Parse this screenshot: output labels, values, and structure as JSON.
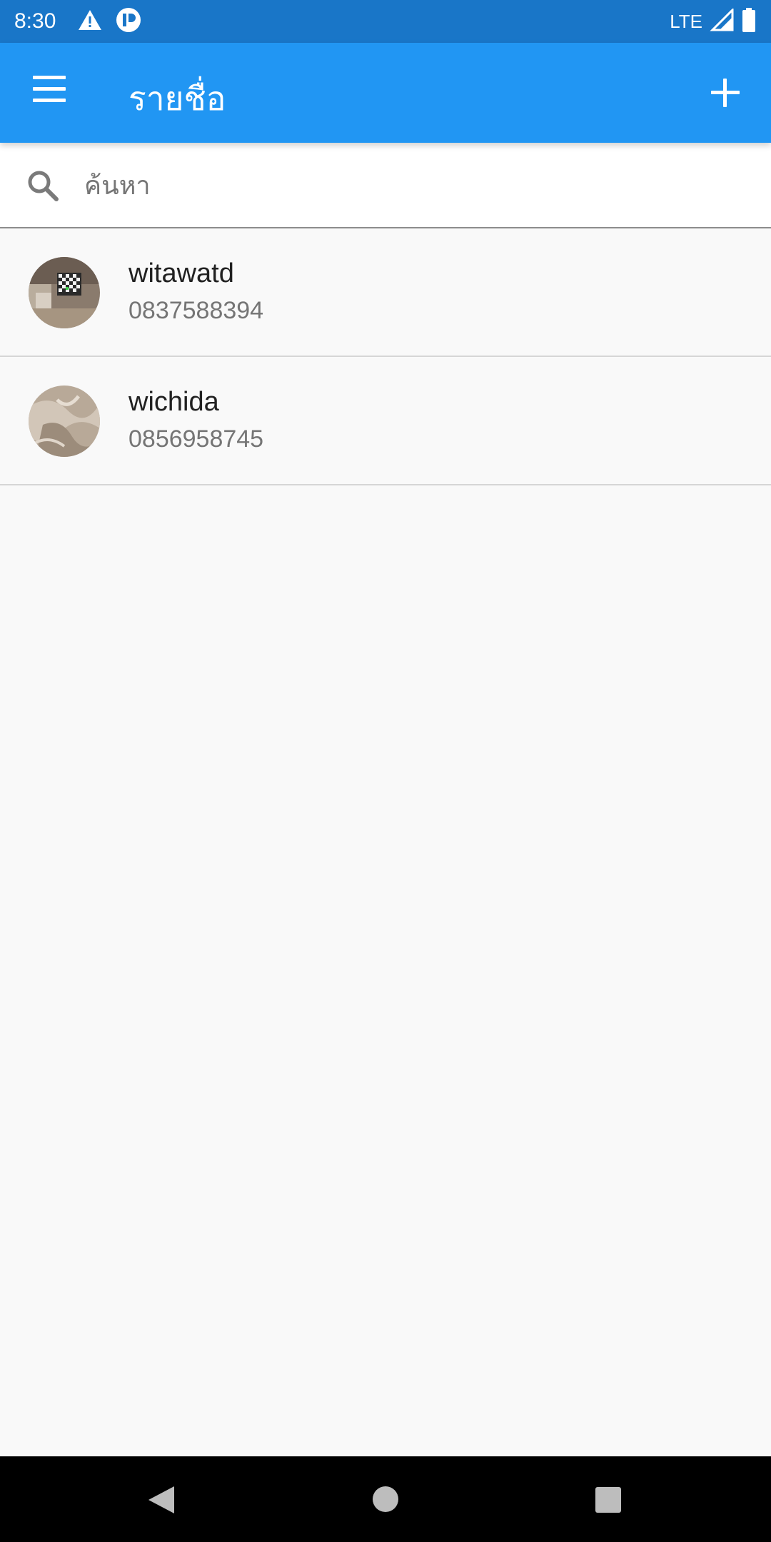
{
  "status_bar": {
    "time": "8:30",
    "network": "LTE",
    "icons": [
      "warning-icon",
      "app-notification-icon",
      "signal-icon",
      "battery-icon"
    ]
  },
  "app_bar": {
    "title": "รายชื่อ",
    "menu_icon": "hamburger-menu-icon",
    "action_icon": "add-icon"
  },
  "search": {
    "placeholder": "ค้นหา",
    "value": ""
  },
  "contacts": [
    {
      "name": "witawatd",
      "phone": "0837588394",
      "avatar": "photo-room"
    },
    {
      "name": "wichida",
      "phone": "0856958745",
      "avatar": "photo-fabric"
    }
  ],
  "nav_bar": {
    "icons": [
      "back-icon",
      "home-icon",
      "recents-icon"
    ]
  },
  "colors": {
    "status_bar": "#1976c8",
    "app_bar": "#2196f3",
    "background": "#f9f9f9",
    "divider": "#d6d6d6",
    "nav_bar": "#000000"
  }
}
